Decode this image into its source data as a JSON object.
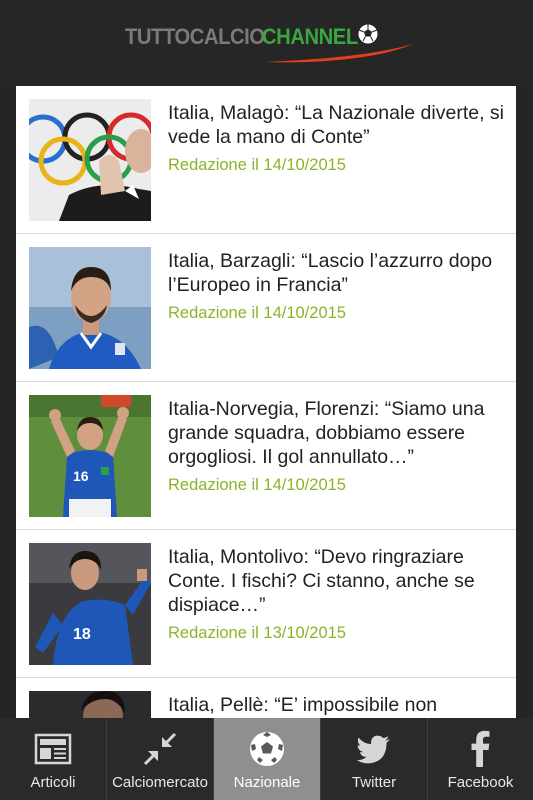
{
  "header": {
    "logo_part1": "TUTTOCALCIO",
    "logo_part2": "CHANNEL"
  },
  "articles": [
    {
      "title": "Italia, Malagò: “La Nazionale diverte, si vede la mano di Conte”",
      "meta": "Redazione il 14/10/2015",
      "thumb": "olympic-rings-official-photo"
    },
    {
      "title": "Italia, Barzagli: “Lascio l’azzurro dopo l’Europeo in Francia”",
      "meta": "Redazione il 14/10/2015",
      "thumb": "player-blue-jersey-photo"
    },
    {
      "title": "Italia-Norvegia, Florenzi: “Siamo una grande squadra, dobbiamo essere orgogliosi. Il gol annullato…”",
      "meta": "Redazione il 14/10/2015",
      "thumb": "player-16-celebrating-photo"
    },
    {
      "title": "Italia, Montolivo: “Devo ringraziare Conte. I fischi? Ci stanno, anche se dispiace…”",
      "meta": "Redazione il 13/10/2015",
      "thumb": "player-18-running-photo"
    },
    {
      "title": "Italia, Pellè: “E’ impossibile non",
      "meta": "",
      "thumb": "player-dark-photo"
    }
  ],
  "tabs": [
    {
      "label": "Articoli",
      "icon": "newspaper-icon",
      "active": false
    },
    {
      "label": "Calciomercato",
      "icon": "transfer-arrows-icon",
      "active": false
    },
    {
      "label": "Nazionale",
      "icon": "soccer-ball-icon",
      "active": true
    },
    {
      "label": "Twitter",
      "icon": "twitter-bird-icon",
      "active": false
    },
    {
      "label": "Facebook",
      "icon": "facebook-icon",
      "active": false
    }
  ],
  "colors": {
    "background": "#252525",
    "meta_text": "#8ab52a",
    "logo_gray": "#7a7a7a",
    "logo_green": "#3aa63d",
    "logo_swoosh": "#e2401c",
    "tab_active": "#8f8f8f"
  }
}
